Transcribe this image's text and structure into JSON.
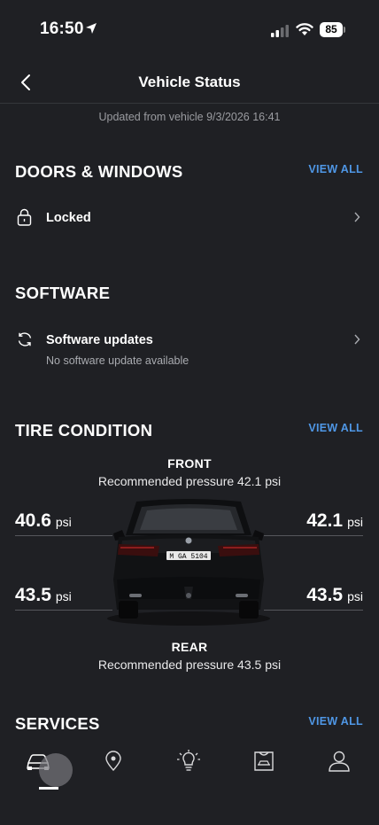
{
  "status_bar": {
    "time": "16:50",
    "battery": "85"
  },
  "nav": {
    "title": "Vehicle Status"
  },
  "updated": "Updated from vehicle 9/3/2026 16:41",
  "doors": {
    "title": "DOORS & WINDOWS",
    "view_all": "VIEW ALL",
    "status": "Locked"
  },
  "software": {
    "title": "SOFTWARE",
    "item_label": "Software updates",
    "item_sub": "No software update available"
  },
  "tires": {
    "title": "TIRE CONDITION",
    "view_all": "VIEW ALL",
    "front_label": "FRONT",
    "front_rec": "Recommended pressure 42.1 psi",
    "rear_label": "REAR",
    "rear_rec": "Recommended pressure 43.5 psi",
    "front_left": "40.6",
    "front_right": "42.1",
    "rear_left": "43.5",
    "rear_right": "43.5",
    "unit": "psi",
    "plate": "M GA 5104"
  },
  "services": {
    "title": "SERVICES",
    "view_all": "VIEW ALL"
  },
  "tabs": [
    "car-icon",
    "map-pin-icon",
    "lightbulb-icon",
    "shop-icon",
    "profile-icon"
  ],
  "colors": {
    "background": "#1f2024",
    "accent": "#4f97e6"
  }
}
